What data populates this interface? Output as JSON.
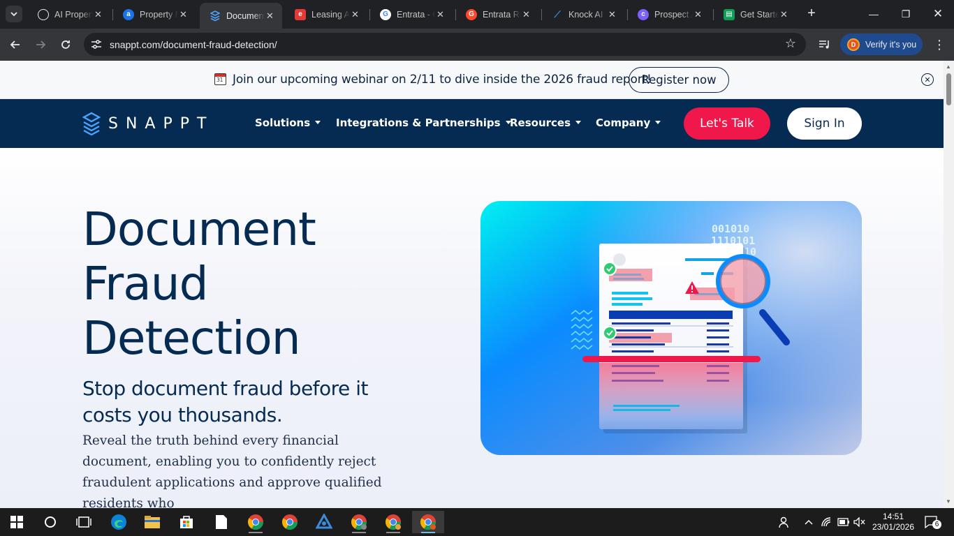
{
  "browser": {
    "tabs": [
      {
        "label": "AI Property Management",
        "icon": "openai-icon",
        "color": "#202124"
      },
      {
        "label": "Property Management AI",
        "icon": "a-logo-icon",
        "color": "#1a73e8"
      },
      {
        "label": "Document Fraud Detection",
        "icon": "snappt-icon",
        "color": "#4aa3ff",
        "active": true
      },
      {
        "label": "Leasing AI",
        "icon": "entrata-e-icon",
        "color": "#e53935"
      },
      {
        "label": "Entrata - Google Search",
        "icon": "google-icon",
        "color": "#ffffff"
      },
      {
        "label": "Entrata Reviews",
        "icon": "g2-icon",
        "color": "#ff492c"
      },
      {
        "label": "Knock AI",
        "icon": "knock-icon",
        "color": "#3a8dde"
      },
      {
        "label": "Prospect AI",
        "icon": "prospect-icon",
        "color": "#7b61ff"
      },
      {
        "label": "Get Started",
        "icon": "sheet-icon",
        "color": "#0f9d58"
      }
    ],
    "url": "snappt.com/document-fraud-detection/",
    "verify_label": "Verify it's you",
    "profile_initial": "D"
  },
  "banner": {
    "calendar_day": "31",
    "message": "Join our upcoming webinar on 2/11 to dive inside the 2026 fraud report!",
    "button": "Register now"
  },
  "nav": {
    "logo": "SNAPPT",
    "menu": [
      "Solutions",
      "Integrations & Partnerships",
      "Resources",
      "Company"
    ],
    "cta": "Let's Talk",
    "signin": "Sign In"
  },
  "hero": {
    "title": "Document Fraud Detection",
    "subtitle": "Stop document fraud before it costs you thousands.",
    "description": "Reveal the truth behind every financial document, enabling you to confidently reject fraudulent applications and approve qualified residents who",
    "binary": [
      "001010",
      "1110101",
      "10",
      "01"
    ],
    "colors": {
      "navy": "#062b52",
      "pink": "#f0174b",
      "cyan": "#00e5f0",
      "blue": "#0a3db3"
    }
  },
  "taskbar": {
    "time": "14:51",
    "date": "23/01/2026",
    "notifications": "6"
  }
}
